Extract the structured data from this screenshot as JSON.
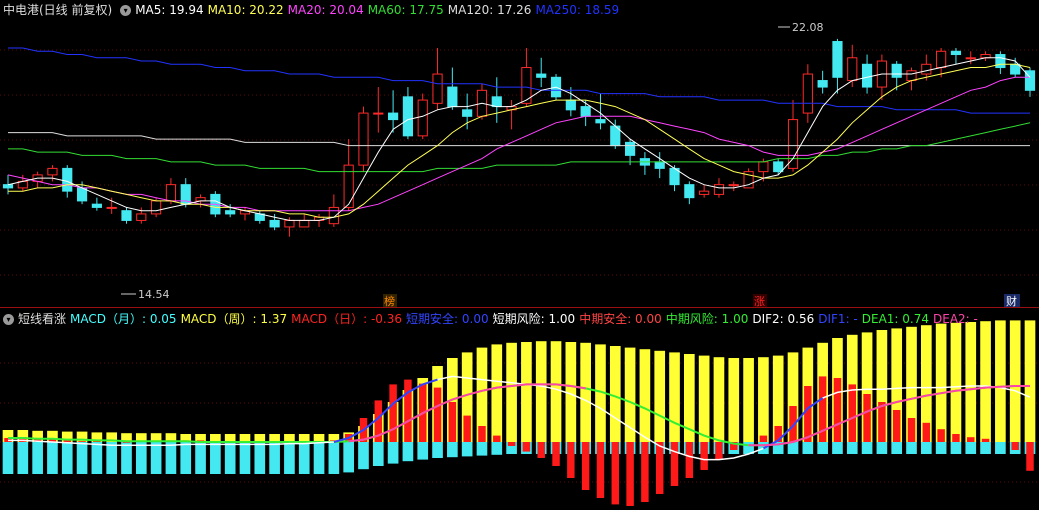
{
  "top": {
    "title": "中电港(日线 前复权)",
    "ma": [
      {
        "label": "MA5: 19.94",
        "color": "#ffffff"
      },
      {
        "label": "MA10: 20.22",
        "color": "#ffff55"
      },
      {
        "label": "MA20: 20.04",
        "color": "#ff44ff"
      },
      {
        "label": "MA60: 17.75",
        "color": "#33dd33"
      },
      {
        "label": "MA120: 17.26",
        "color": "#dddddd"
      },
      {
        "label": "MA250: 18.59",
        "color": "#2233ff"
      }
    ],
    "high_label": "22.08",
    "low_label": "14.54",
    "markers": [
      {
        "label": "榜",
        "color": "#ff8800",
        "bg": "#332200"
      },
      {
        "label": "涨",
        "color": "#ff2222",
        "bg": "#330000"
      },
      {
        "label": "财",
        "color": "#ffffff",
        "bg": "#1a2a66"
      }
    ]
  },
  "bottom": {
    "title": "短线看涨",
    "items": [
      {
        "label": "MACD（月）: 0.05",
        "color": "#44ffff"
      },
      {
        "label": "MACD（周）: 1.37",
        "color": "#ffff44"
      },
      {
        "label": "MACD（日）: -0.36",
        "color": "#ff2222"
      },
      {
        "label": "短期安全: 0.00",
        "color": "#3344ff"
      },
      {
        "label": "短期风险: 1.00",
        "color": "#ffffff"
      },
      {
        "label": "中期安全: 0.00",
        "color": "#ff4444"
      },
      {
        "label": "中期风险: 1.00",
        "color": "#33ee33"
      },
      {
        "label": "DIF2: 0.56",
        "color": "#ffffff"
      },
      {
        "label": "DIF1: -",
        "color": "#3344ff"
      },
      {
        "label": "DEA1: 0.74",
        "color": "#33ee33"
      },
      {
        "label": "DEA2: -",
        "color": "#ff44aa"
      }
    ]
  },
  "colors": {
    "up": "#ff2a2a",
    "down": "#44e8f0",
    "bg": "#000000",
    "grid": "#5a0a0a"
  },
  "series": {
    "candles": [
      [
        17.6,
        17.5,
        17.9,
        17.3
      ],
      [
        17.5,
        17.7,
        17.9,
        17.4
      ],
      [
        17.7,
        17.9,
        18.0,
        17.5
      ],
      [
        17.9,
        18.1,
        18.2,
        17.7
      ],
      [
        18.1,
        17.4,
        18.2,
        17.2
      ],
      [
        17.5,
        17.1,
        17.7,
        17.0
      ],
      [
        17.0,
        16.9,
        17.2,
        16.8
      ],
      [
        16.9,
        16.9,
        17.2,
        16.7
      ],
      [
        16.8,
        16.5,
        16.9,
        16.4
      ],
      [
        16.5,
        16.7,
        16.9,
        16.4
      ],
      [
        16.7,
        17.1,
        17.2,
        16.6
      ],
      [
        17.1,
        17.6,
        17.8,
        17.0
      ],
      [
        17.6,
        17.0,
        17.8,
        16.9
      ],
      [
        17.1,
        17.2,
        17.3,
        16.9
      ],
      [
        17.3,
        16.7,
        17.4,
        16.6
      ],
      [
        16.8,
        16.7,
        17.0,
        16.6
      ],
      [
        16.7,
        16.8,
        16.9,
        16.5
      ],
      [
        16.7,
        16.5,
        16.8,
        16.4
      ],
      [
        16.5,
        16.3,
        16.7,
        16.2
      ],
      [
        16.3,
        16.5,
        16.6,
        16.0
      ],
      [
        16.3,
        16.5,
        16.7,
        16.3
      ],
      [
        16.5,
        16.6,
        16.7,
        16.3
      ],
      [
        16.4,
        16.9,
        17.3,
        16.3
      ],
      [
        16.9,
        18.2,
        19.0,
        16.8
      ],
      [
        18.2,
        19.8,
        20.0,
        18.0
      ],
      [
        19.8,
        19.8,
        20.6,
        19.2
      ],
      [
        19.8,
        19.6,
        20.5,
        19.2
      ],
      [
        20.3,
        19.1,
        20.6,
        19.0
      ],
      [
        19.1,
        20.2,
        20.4,
        19.0
      ],
      [
        20.1,
        21.0,
        21.8,
        19.9
      ],
      [
        20.6,
        20.0,
        21.2,
        19.9
      ],
      [
        19.9,
        19.7,
        20.4,
        19.3
      ],
      [
        19.7,
        20.5,
        20.7,
        19.6
      ],
      [
        20.3,
        20.0,
        20.9,
        19.5
      ],
      [
        19.9,
        20.0,
        20.2,
        19.3
      ],
      [
        20.1,
        21.2,
        21.8,
        20.0
      ],
      [
        21.0,
        20.9,
        21.5,
        20.6
      ],
      [
        20.9,
        20.3,
        21.0,
        20.2
      ],
      [
        20.2,
        19.9,
        20.6,
        19.7
      ],
      [
        20.0,
        19.7,
        20.2,
        19.4
      ],
      [
        19.6,
        19.5,
        20.4,
        19.3
      ],
      [
        19.4,
        18.8,
        19.6,
        18.7
      ],
      [
        18.9,
        18.5,
        19.0,
        18.2
      ],
      [
        18.4,
        18.2,
        18.6,
        17.9
      ],
      [
        18.3,
        18.1,
        18.6,
        17.8
      ],
      [
        18.1,
        17.6,
        18.2,
        17.4
      ],
      [
        17.6,
        17.2,
        17.7,
        17.0
      ],
      [
        17.3,
        17.4,
        17.6,
        17.2
      ],
      [
        17.3,
        17.6,
        17.8,
        17.2
      ],
      [
        17.6,
        17.6,
        17.7,
        17.4
      ],
      [
        17.5,
        18.0,
        18.1,
        17.5
      ],
      [
        18.0,
        18.3,
        18.4,
        17.7
      ],
      [
        18.3,
        18.0,
        18.4,
        17.9
      ],
      [
        18.1,
        19.6,
        20.2,
        18.0
      ],
      [
        19.8,
        21.0,
        21.3,
        19.5
      ],
      [
        20.8,
        20.6,
        21.1,
        20.4
      ],
      [
        22.0,
        20.9,
        22.08,
        20.4
      ],
      [
        20.8,
        21.5,
        21.9,
        20.6
      ],
      [
        21.3,
        20.6,
        21.6,
        20.4
      ],
      [
        20.6,
        21.4,
        21.6,
        20.2
      ],
      [
        21.3,
        20.9,
        21.4,
        20.5
      ],
      [
        20.8,
        21.1,
        21.2,
        20.5
      ],
      [
        21.0,
        21.3,
        21.6,
        20.8
      ],
      [
        21.2,
        21.7,
        21.8,
        20.9
      ],
      [
        21.7,
        21.6,
        21.8,
        21.3
      ],
      [
        21.5,
        21.5,
        21.7,
        21.3
      ],
      [
        21.5,
        21.6,
        21.7,
        21.4
      ],
      [
        21.6,
        21.2,
        21.7,
        21.0
      ],
      [
        21.3,
        21.0,
        21.5,
        20.9
      ],
      [
        21.1,
        20.5,
        21.2,
        20.3
      ]
    ],
    "ma5": [
      17.6,
      17.7,
      17.8,
      17.8,
      17.7,
      17.5,
      17.3,
      17.1,
      16.9,
      16.8,
      16.8,
      16.9,
      17.0,
      17.1,
      17.1,
      16.9,
      16.8,
      16.7,
      16.6,
      16.5,
      16.5,
      16.5,
      16.6,
      17.0,
      17.8,
      18.6,
      19.3,
      19.6,
      19.7,
      19.9,
      20.0,
      20.0,
      20.1,
      20.0,
      20.0,
      20.2,
      20.5,
      20.6,
      20.4,
      20.1,
      19.8,
      19.4,
      19.0,
      18.7,
      18.4,
      18.1,
      17.8,
      17.6,
      17.5,
      17.5,
      17.6,
      17.8,
      17.9,
      18.4,
      19.2,
      20.0,
      20.5,
      20.8,
      20.9,
      21.0,
      21.0,
      21.0,
      21.1,
      21.2,
      21.3,
      21.4,
      21.5,
      21.5,
      21.4,
      20.9
    ],
    "ma10": [
      17.4,
      17.4,
      17.5,
      17.5,
      17.6,
      17.6,
      17.5,
      17.4,
      17.3,
      17.2,
      17.1,
      17.1,
      17.0,
      17.0,
      16.9,
      16.9,
      16.8,
      16.8,
      16.8,
      16.7,
      16.7,
      16.6,
      16.6,
      16.7,
      17.0,
      17.4,
      17.8,
      18.2,
      18.5,
      18.8,
      19.2,
      19.5,
      19.7,
      19.8,
      19.9,
      20.0,
      20.1,
      20.2,
      20.2,
      20.2,
      20.1,
      20.0,
      19.8,
      19.6,
      19.3,
      19.0,
      18.7,
      18.4,
      18.2,
      18.0,
      17.9,
      17.8,
      17.8,
      17.9,
      18.2,
      18.6,
      19.0,
      19.5,
      19.9,
      20.3,
      20.6,
      20.8,
      20.9,
      21.0,
      21.1,
      21.2,
      21.2,
      21.3,
      21.3,
      21.2
    ],
    "ma20": [
      17.9,
      17.8,
      17.7,
      17.6,
      17.6,
      17.5,
      17.5,
      17.4,
      17.3,
      17.3,
      17.2,
      17.1,
      17.1,
      17.0,
      17.0,
      16.9,
      16.9,
      16.8,
      16.8,
      16.8,
      16.8,
      16.8,
      16.8,
      16.8,
      16.9,
      17.0,
      17.2,
      17.4,
      17.6,
      17.8,
      18.0,
      18.2,
      18.4,
      18.7,
      18.9,
      19.1,
      19.3,
      19.5,
      19.6,
      19.7,
      19.7,
      19.7,
      19.7,
      19.6,
      19.5,
      19.4,
      19.3,
      19.2,
      19.0,
      18.9,
      18.8,
      18.6,
      18.5,
      18.5,
      18.5,
      18.6,
      18.7,
      18.9,
      19.1,
      19.3,
      19.5,
      19.7,
      19.9,
      20.1,
      20.3,
      20.5,
      20.6,
      20.8,
      20.9,
      20.9
    ],
    "ma60": [
      18.7,
      18.7,
      18.6,
      18.6,
      18.6,
      18.5,
      18.5,
      18.5,
      18.4,
      18.4,
      18.4,
      18.3,
      18.3,
      18.3,
      18.2,
      18.2,
      18.2,
      18.1,
      18.1,
      18.1,
      18.1,
      18.0,
      18.0,
      18.0,
      18.0,
      18.0,
      18.0,
      18.0,
      18.0,
      18.1,
      18.1,
      18.1,
      18.1,
      18.2,
      18.2,
      18.2,
      18.2,
      18.2,
      18.3,
      18.3,
      18.3,
      18.3,
      18.3,
      18.3,
      18.3,
      18.3,
      18.3,
      18.3,
      18.3,
      18.3,
      18.3,
      18.3,
      18.4,
      18.4,
      18.4,
      18.5,
      18.5,
      18.6,
      18.6,
      18.7,
      18.7,
      18.8,
      18.8,
      18.9,
      19.0,
      19.1,
      19.2,
      19.3,
      19.4,
      19.5
    ],
    "ma120": [
      19.2,
      19.2,
      19.2,
      19.2,
      19.1,
      19.1,
      19.1,
      19.1,
      19.1,
      19.1,
      19.0,
      19.0,
      19.0,
      19.0,
      19.0,
      19.0,
      18.9,
      18.9,
      18.9,
      18.9,
      18.9,
      18.9,
      18.9,
      18.8,
      18.8,
      18.8,
      18.8,
      18.8,
      18.8,
      18.8,
      18.8,
      18.8,
      18.8,
      18.8,
      18.8,
      18.8,
      18.8,
      18.8,
      18.8,
      18.8,
      18.8,
      18.8,
      18.8,
      18.8,
      18.8,
      18.8,
      18.8,
      18.8,
      18.8,
      18.8,
      18.8,
      18.8,
      18.8,
      18.8,
      18.8,
      18.8,
      18.8,
      18.8,
      18.8,
      18.8,
      18.8,
      18.8,
      18.8,
      18.8,
      18.8,
      18.8,
      18.8,
      18.8,
      18.8,
      18.8
    ],
    "ma250": [
      21.8,
      21.8,
      21.7,
      21.7,
      21.6,
      21.6,
      21.5,
      21.5,
      21.5,
      21.4,
      21.4,
      21.3,
      21.3,
      21.3,
      21.2,
      21.2,
      21.1,
      21.1,
      21.1,
      21.0,
      21.0,
      21.0,
      20.9,
      20.9,
      20.9,
      20.9,
      20.8,
      20.8,
      20.8,
      20.7,
      20.7,
      20.7,
      20.7,
      20.6,
      20.6,
      20.6,
      20.5,
      20.5,
      20.5,
      20.5,
      20.4,
      20.4,
      20.4,
      20.4,
      20.3,
      20.3,
      20.3,
      20.3,
      20.2,
      20.2,
      20.2,
      20.2,
      20.1,
      20.1,
      20.1,
      20.1,
      20.0,
      20.0,
      20.0,
      20.0,
      19.9,
      19.9,
      19.9,
      19.9,
      19.9,
      19.8,
      19.8,
      19.8,
      19.8,
      19.8
    ],
    "macd_yellow": [
      0.15,
      0.15,
      0.14,
      0.14,
      0.13,
      0.13,
      0.12,
      0.12,
      0.11,
      0.11,
      0.11,
      0.11,
      0.1,
      0.1,
      0.1,
      0.1,
      0.1,
      0.1,
      0.1,
      0.1,
      0.1,
      0.1,
      0.1,
      0.12,
      0.2,
      0.35,
      0.5,
      0.65,
      0.8,
      0.95,
      1.05,
      1.12,
      1.18,
      1.22,
      1.24,
      1.25,
      1.26,
      1.26,
      1.25,
      1.24,
      1.22,
      1.2,
      1.18,
      1.16,
      1.14,
      1.12,
      1.1,
      1.08,
      1.06,
      1.05,
      1.05,
      1.06,
      1.08,
      1.12,
      1.18,
      1.24,
      1.3,
      1.34,
      1.37,
      1.4,
      1.42,
      1.44,
      1.46,
      1.48,
      1.49,
      1.5,
      1.51,
      1.52,
      1.52,
      1.52
    ],
    "macd_cyan": [
      -0.4,
      -0.4,
      -0.4,
      -0.4,
      -0.4,
      -0.4,
      -0.4,
      -0.4,
      -0.4,
      -0.4,
      -0.4,
      -0.4,
      -0.4,
      -0.4,
      -0.4,
      -0.4,
      -0.4,
      -0.4,
      -0.4,
      -0.4,
      -0.4,
      -0.4,
      -0.4,
      -0.38,
      -0.34,
      -0.3,
      -0.27,
      -0.24,
      -0.22,
      -0.2,
      -0.19,
      -0.18,
      -0.17,
      -0.16,
      -0.15,
      -0.15,
      -0.15,
      -0.15,
      -0.15,
      -0.15,
      -0.15,
      -0.15,
      -0.15,
      -0.15,
      -0.15,
      -0.15,
      -0.15,
      -0.15,
      -0.15,
      -0.15,
      -0.15,
      -0.15,
      -0.15,
      -0.15,
      -0.15,
      -0.15,
      -0.15,
      -0.15,
      -0.15,
      -0.15,
      -0.15,
      -0.15,
      -0.15,
      -0.15,
      -0.15,
      -0.15,
      -0.15,
      -0.15,
      -0.15,
      -0.15
    ],
    "macd_red": [
      0.05,
      0.06,
      0.05,
      0.04,
      0.02,
      0.01,
      0.01,
      0.0,
      -0.01,
      0.0,
      0.01,
      0.02,
      0.02,
      0.02,
      0.01,
      0.01,
      0.0,
      0.0,
      0.0,
      0.0,
      0.01,
      0.01,
      0.02,
      0.1,
      0.3,
      0.52,
      0.72,
      0.78,
      0.73,
      0.68,
      0.5,
      0.33,
      0.2,
      0.08,
      -0.05,
      -0.12,
      -0.2,
      -0.3,
      -0.45,
      -0.6,
      -0.7,
      -0.78,
      -0.8,
      -0.75,
      -0.65,
      -0.55,
      -0.45,
      -0.35,
      -0.22,
      -0.1,
      0.0,
      0.08,
      0.2,
      0.45,
      0.7,
      0.82,
      0.8,
      0.72,
      0.6,
      0.5,
      0.4,
      0.3,
      0.24,
      0.16,
      0.1,
      0.06,
      0.04,
      0.0,
      -0.1,
      -0.36
    ],
    "dif": [
      0.02,
      0.02,
      0.01,
      0.0,
      -0.01,
      -0.02,
      -0.03,
      -0.04,
      -0.04,
      -0.04,
      -0.04,
      -0.04,
      -0.03,
      -0.03,
      -0.03,
      -0.03,
      -0.03,
      -0.03,
      -0.03,
      -0.02,
      -0.02,
      -0.01,
      0.0,
      0.05,
      0.15,
      0.3,
      0.48,
      0.62,
      0.72,
      0.78,
      0.82,
      0.8,
      0.78,
      0.76,
      0.74,
      0.72,
      0.7,
      0.66,
      0.6,
      0.52,
      0.42,
      0.3,
      0.18,
      0.06,
      -0.05,
      -0.12,
      -0.18,
      -0.22,
      -0.22,
      -0.2,
      -0.15,
      -0.08,
      0.02,
      0.2,
      0.42,
      0.55,
      0.62,
      0.65,
      0.66,
      0.66,
      0.67,
      0.68,
      0.68,
      0.68,
      0.69,
      0.7,
      0.7,
      0.68,
      0.64,
      0.56
    ],
    "dea": [
      0.05,
      0.05,
      0.04,
      0.04,
      0.03,
      0.03,
      0.02,
      0.02,
      0.01,
      0.01,
      0.01,
      0.01,
      0.01,
      0.0,
      0.0,
      0.0,
      0.0,
      0.0,
      0.0,
      0.0,
      0.0,
      0.0,
      0.0,
      0.01,
      0.03,
      0.08,
      0.16,
      0.26,
      0.36,
      0.45,
      0.53,
      0.59,
      0.64,
      0.68,
      0.7,
      0.72,
      0.72,
      0.72,
      0.7,
      0.67,
      0.63,
      0.57,
      0.5,
      0.42,
      0.33,
      0.24,
      0.16,
      0.08,
      0.02,
      -0.02,
      -0.04,
      -0.04,
      -0.03,
      0.0,
      0.06,
      0.14,
      0.22,
      0.3,
      0.38,
      0.45,
      0.5,
      0.54,
      0.58,
      0.61,
      0.64,
      0.66,
      0.68,
      0.69,
      0.7,
      0.7
    ]
  }
}
